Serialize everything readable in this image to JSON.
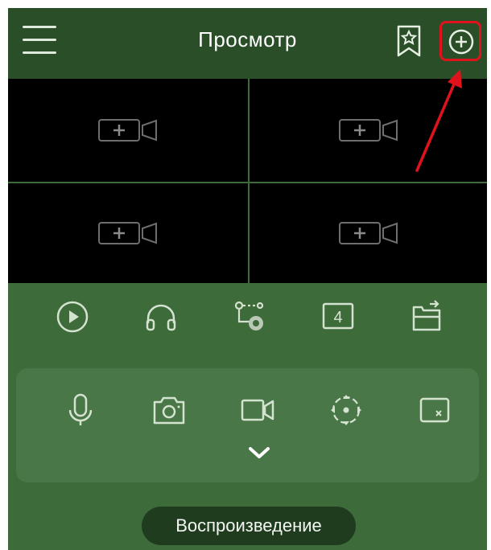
{
  "header": {
    "title": "Просмотр"
  },
  "grid": {
    "cells": [
      {
        "icon": "add-camera-icon"
      },
      {
        "icon": "add-camera-icon"
      },
      {
        "icon": "add-camera-icon"
      },
      {
        "icon": "add-camera-icon"
      }
    ]
  },
  "toolbar": {
    "items": [
      "play-icon",
      "headphones-icon",
      "ptz-icon",
      "layout-4-icon",
      "switch-stream-icon"
    ],
    "layout_count": "4"
  },
  "panel": {
    "items": [
      "microphone-icon",
      "snapshot-icon",
      "record-icon",
      "ptz-direction-icon",
      "close-window-icon"
    ]
  },
  "playback": {
    "label": "Воспроизведение"
  },
  "colors": {
    "header_bg": "#2a4f28",
    "body_bg": "#3d6b3a",
    "panel_bg": "#4a7747",
    "highlight": "#e0121c"
  }
}
